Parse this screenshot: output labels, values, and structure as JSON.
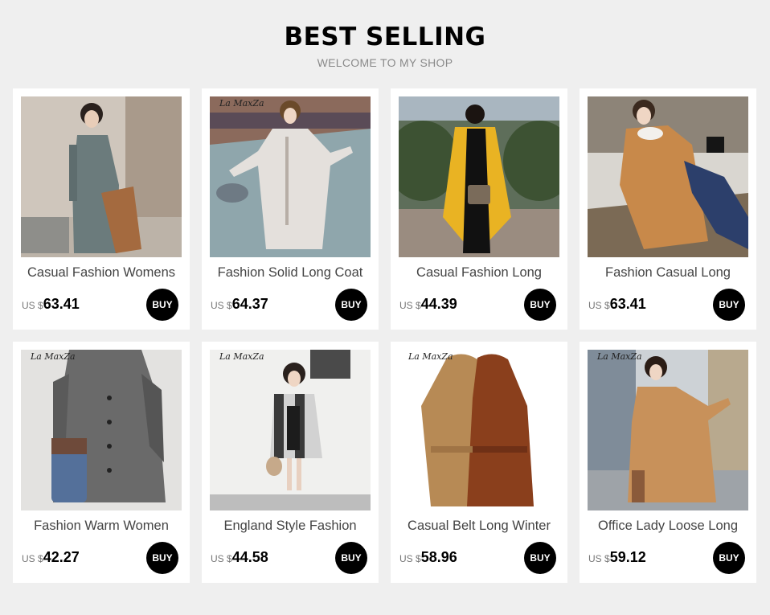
{
  "header": {
    "title": "BEST SELLING",
    "subtitle": "WELCOME TO MY SHOP"
  },
  "products": [
    {
      "name": "Casual Fashion Womens",
      "currency": "US $",
      "price": "63.41",
      "buy_label": "BUY",
      "brand_mark": "",
      "image": "gray-wool-coat-photo"
    },
    {
      "name": "Fashion Solid Long Coat",
      "currency": "US $",
      "price": "64.37",
      "buy_label": "BUY",
      "brand_mark": "La MaxZa",
      "image": "white-toggle-coat-photo"
    },
    {
      "name": "Casual Fashion Long",
      "currency": "US $",
      "price": "44.39",
      "buy_label": "BUY",
      "brand_mark": "",
      "image": "yellow-coat-photo"
    },
    {
      "name": "Fashion Casual Long",
      "currency": "US $",
      "price": "63.41",
      "buy_label": "BUY",
      "brand_mark": "",
      "image": "camel-toggle-coat-photo"
    },
    {
      "name": "Fashion Warm Women",
      "currency": "US $",
      "price": "42.27",
      "buy_label": "BUY",
      "brand_mark": "La MaxZa",
      "image": "gray-cape-coat-photo"
    },
    {
      "name": "England Style Fashion",
      "currency": "US $",
      "price": "44.58",
      "buy_label": "BUY",
      "brand_mark": "La MaxZa",
      "image": "plaid-coat-photo"
    },
    {
      "name": "Casual Belt Long Winter",
      "currency": "US $",
      "price": "58.96",
      "buy_label": "BUY",
      "brand_mark": "La MaxZa",
      "image": "hooded-belt-coats-photo"
    },
    {
      "name": "Office Lady Loose Long",
      "currency": "US $",
      "price": "59.12",
      "buy_label": "BUY",
      "brand_mark": "La MaxZa",
      "image": "camel-loose-coat-photo"
    }
  ]
}
